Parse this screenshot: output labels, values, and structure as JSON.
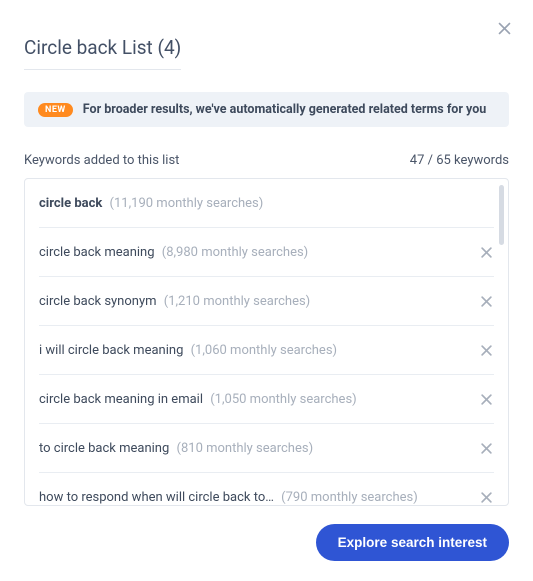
{
  "header": {
    "title": "Circle back List (4)"
  },
  "banner": {
    "badge": "NEW",
    "text": "For broader results, we've automatically generated related terms for you"
  },
  "meta": {
    "left": "Keywords added to this list",
    "right": "47 / 65 keywords"
  },
  "keywords": [
    {
      "term": "circle back",
      "stat": "(11,190 monthly searches)",
      "bold": true,
      "removable": false
    },
    {
      "term": "circle back meaning",
      "stat": "(8,980 monthly searches)",
      "bold": false,
      "removable": true
    },
    {
      "term": "circle back synonym",
      "stat": "(1,210 monthly searches)",
      "bold": false,
      "removable": true
    },
    {
      "term": "i will circle back meaning",
      "stat": "(1,060 monthly searches)",
      "bold": false,
      "removable": true
    },
    {
      "term": "circle back meaning in email",
      "stat": "(1,050 monthly searches)",
      "bold": false,
      "removable": true
    },
    {
      "term": "to circle back meaning",
      "stat": "(810 monthly searches)",
      "bold": false,
      "removable": true
    },
    {
      "term": "how to respond when will circle back to…",
      "stat": "(790 monthly searches)",
      "bold": false,
      "removable": true
    }
  ],
  "cta": {
    "label": "Explore search interest"
  }
}
